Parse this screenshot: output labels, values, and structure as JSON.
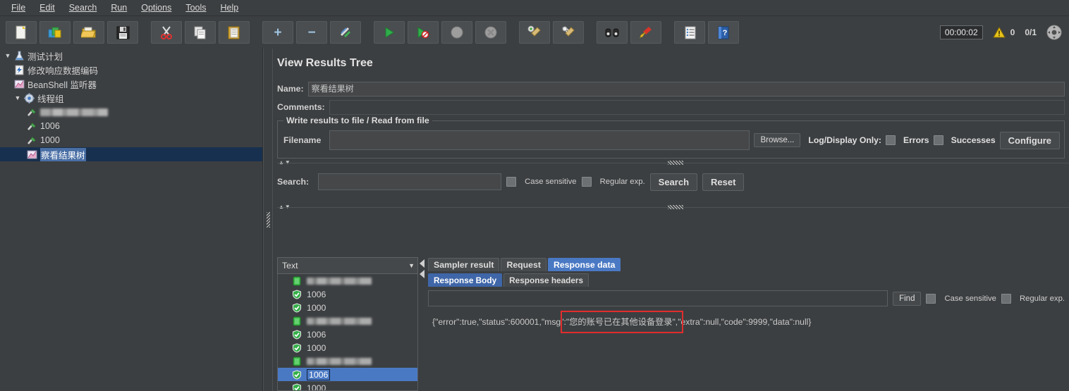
{
  "menu": {
    "items": [
      {
        "label": "File",
        "mnemonic": "F"
      },
      {
        "label": "Edit",
        "mnemonic": "E"
      },
      {
        "label": "Search",
        "mnemonic": "S"
      },
      {
        "label": "Run",
        "mnemonic": "R"
      },
      {
        "label": "Options",
        "mnemonic": "O"
      },
      {
        "label": "Tools",
        "mnemonic": "T"
      },
      {
        "label": "Help",
        "mnemonic": "H"
      }
    ]
  },
  "toolbar": {
    "buttons": [
      {
        "name": "new-icon",
        "title": "New"
      },
      {
        "name": "templates-icon",
        "title": "Templates"
      },
      {
        "name": "open-icon",
        "title": "Open"
      },
      {
        "name": "save-icon",
        "title": "Save Test Plan"
      },
      {
        "name": "cut-icon",
        "title": "Cut"
      },
      {
        "name": "copy-icon",
        "title": "Copy"
      },
      {
        "name": "paste-icon",
        "title": "Paste"
      },
      {
        "name": "expand-all-icon",
        "title": "Expand All"
      },
      {
        "name": "collapse-all-icon",
        "title": "Collapse All"
      },
      {
        "name": "toggle-icon",
        "title": "Toggle"
      },
      {
        "name": "start-icon",
        "title": "Start"
      },
      {
        "name": "start-no-pauses-icon",
        "title": "Start no pauses"
      },
      {
        "name": "stop-icon",
        "title": "Stop"
      },
      {
        "name": "shutdown-icon",
        "title": "Shutdown"
      },
      {
        "name": "clear-icon",
        "title": "Clear"
      },
      {
        "name": "clear-all-icon",
        "title": "Clear All"
      },
      {
        "name": "search-icon",
        "title": "Search"
      },
      {
        "name": "reset-search-icon",
        "title": "Reset Search"
      },
      {
        "name": "function-helper-icon",
        "title": "Function Helper Dialog"
      },
      {
        "name": "help-icon",
        "title": "Help"
      }
    ],
    "timer": "00:00:02",
    "warning_count": "0",
    "thread_ratio": "0/1"
  },
  "tree": {
    "nodes": [
      {
        "label": "测试计划",
        "icon": "test-plan-icon",
        "indent": 0,
        "toggle": "▼",
        "selected": false,
        "blurred": false
      },
      {
        "label": "修改响应数据编码",
        "icon": "beanshell-preprocessor-icon",
        "indent": 1,
        "toggle": "",
        "selected": false,
        "blurred": false
      },
      {
        "label": "BeanShell 监听器",
        "icon": "beanshell-listener-icon",
        "indent": 1,
        "toggle": "",
        "selected": false,
        "blurred": false
      },
      {
        "label": "线程组",
        "icon": "thread-group-icon",
        "indent": 1,
        "toggle": "▼",
        "selected": false,
        "blurred": false
      },
      {
        "label": "",
        "icon": "http-sampler-icon",
        "indent": 2,
        "toggle": "",
        "selected": false,
        "blurred": true
      },
      {
        "label": "1006",
        "icon": "http-sampler-icon",
        "indent": 2,
        "toggle": "",
        "selected": false,
        "blurred": false
      },
      {
        "label": "1000",
        "icon": "http-sampler-icon",
        "indent": 2,
        "toggle": "",
        "selected": false,
        "blurred": false
      },
      {
        "label": "察看结果树",
        "icon": "view-results-tree-icon",
        "indent": 2,
        "toggle": "",
        "selected": true,
        "blurred": false
      }
    ]
  },
  "panel": {
    "title": "View Results Tree",
    "name_label": "Name:",
    "name_value": "察看结果树",
    "comments_label": "Comments:",
    "comments_value": "",
    "file_group_label": "Write results to file / Read from file",
    "filename_label": "Filename",
    "filename_value": "",
    "browse_label": "Browse...",
    "log_display_label": "Log/Display Only:",
    "errors_label": "Errors",
    "errors_checked": false,
    "successes_label": "Successes",
    "successes_checked": false,
    "configure_label": "Configure",
    "search_label": "Search:",
    "search_value": "",
    "case_sensitive_label": "Case sensitive",
    "case_sensitive_checked": false,
    "regular_exp_label": "Regular exp.",
    "regular_exp_checked": false,
    "search_button": "Search",
    "reset_button": "Reset"
  },
  "results": {
    "renderer_selected": "Text",
    "rows": [
      {
        "label": "",
        "icon": "sampler-running-icon",
        "blurred": true,
        "selected": false
      },
      {
        "label": "1006",
        "icon": "success-shield-icon",
        "blurred": false,
        "selected": false
      },
      {
        "label": "1000",
        "icon": "success-shield-icon",
        "blurred": false,
        "selected": false
      },
      {
        "label": "",
        "icon": "sampler-running-icon",
        "blurred": true,
        "selected": false
      },
      {
        "label": "1006",
        "icon": "success-shield-icon",
        "blurred": false,
        "selected": false
      },
      {
        "label": "1000",
        "icon": "success-shield-icon",
        "blurred": false,
        "selected": false
      },
      {
        "label": "",
        "icon": "sampler-running-icon",
        "blurred": true,
        "selected": false
      },
      {
        "label": "1006",
        "icon": "success-shield-icon",
        "blurred": false,
        "selected": true
      },
      {
        "label": "1000",
        "icon": "success-shield-icon",
        "blurred": false,
        "selected": false
      }
    ]
  },
  "detail": {
    "tabs": [
      {
        "label": "Sampler result",
        "active": false
      },
      {
        "label": "Request",
        "active": false
      },
      {
        "label": "Response data",
        "active": true
      }
    ],
    "subtabs": [
      {
        "label": "Response Body",
        "active": true
      },
      {
        "label": "Response headers",
        "active": false
      }
    ],
    "find_value": "",
    "find_button": "Find",
    "case_sensitive_label": "Case sensitive",
    "case_sensitive_checked": false,
    "regular_exp_label": "Regular exp.",
    "regular_exp_checked": false,
    "response_body": "{\"error\":true,\"status\":600001,\"msg\":\"您的账号已在其他设备登录\",\"extra\":null,\"code\":9999,\"data\":null}",
    "highlight_text": "您的账号已在其他设备登录"
  },
  "colors": {
    "window_bg": "#3c3f41",
    "accent_blue": "#4a79c4",
    "tab_active": "#4a79c4",
    "tree_selection": "#18304f",
    "highlight_red": "#e12d2d",
    "success_green": "#2fae4a",
    "warning_yellow": "#e8c31a"
  }
}
